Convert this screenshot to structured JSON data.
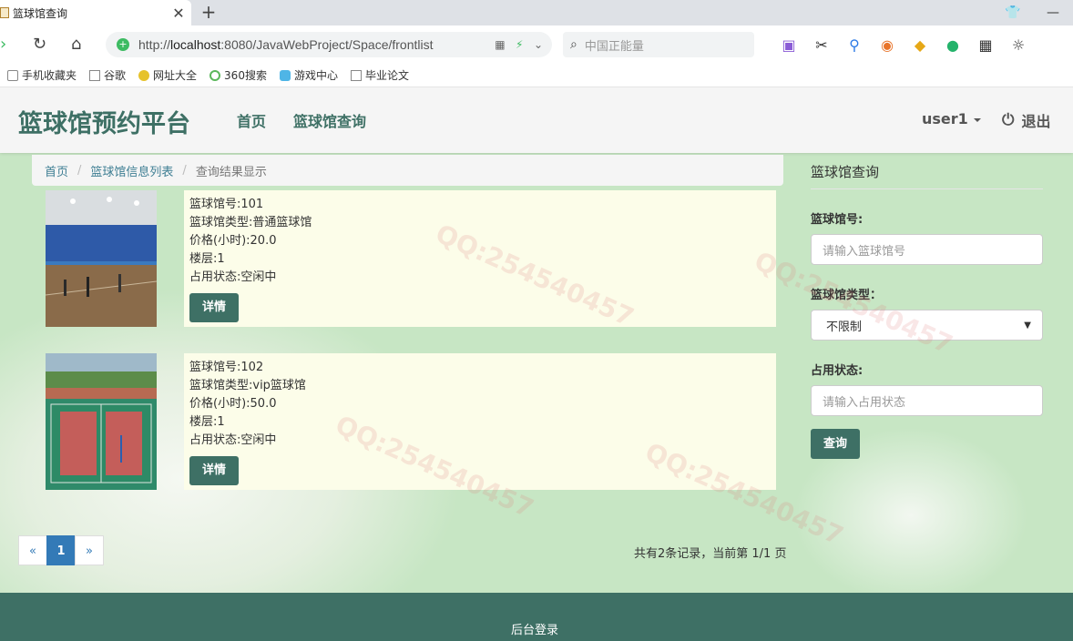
{
  "browser": {
    "tab_title": "篮球馆查询",
    "new_tab": "+",
    "url_host": "localhost",
    "url_rest": ":8080/JavaWebProject/Space/frontlist",
    "search_placeholder": "中国正能量",
    "bookmarks": [
      "手机收藏夹",
      "谷歌",
      "网址大全",
      "360搜索",
      "游戏中心",
      "毕业论文"
    ]
  },
  "site": {
    "brand": "篮球馆预约平台",
    "nav": [
      "首页",
      "篮球馆查询"
    ],
    "user": "user1",
    "logout": "退出"
  },
  "breadcrumb": {
    "home": "首页",
    "list": "篮球馆信息列表",
    "current": "查询结果显示"
  },
  "records": [
    {
      "number": "篮球馆号:101",
      "type": "篮球馆类型:普通篮球馆",
      "price": "价格(小时):20.0",
      "floor": "楼层:1",
      "status": "占用状态:空闲中",
      "detail": "详情"
    },
    {
      "number": "篮球馆号:102",
      "type": "篮球馆类型:vip篮球馆",
      "price": "价格(小时):50.0",
      "floor": "楼层:1",
      "status": "占用状态:空闲中",
      "detail": "详情"
    }
  ],
  "pagination": {
    "prev": "«",
    "current": "1",
    "next": "»",
    "summary": "共有2条记录，当前第 1/1 页"
  },
  "search_panel": {
    "title": "篮球馆查询",
    "number_label": "篮球馆号:",
    "number_placeholder": "请输入篮球馆号",
    "type_label": "篮球馆类型：",
    "type_selected": "不限制",
    "status_label": "占用状态:",
    "status_placeholder": "请输入占用状态",
    "submit": "查询"
  },
  "footer": {
    "admin_login": "后台登录"
  },
  "colors": {
    "primary": "#3e7065",
    "background": "#c7e6c4",
    "card": "#fcfde9",
    "link": "#337ab7"
  }
}
